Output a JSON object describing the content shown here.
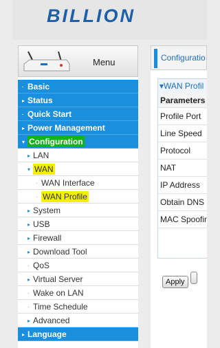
{
  "header": {
    "logo": "BILLION"
  },
  "menu": {
    "label": "Menu",
    "items": [
      {
        "label": "Basic",
        "level": "top",
        "bullet": "·"
      },
      {
        "label": "Status",
        "level": "top",
        "bullet": "▸"
      },
      {
        "label": "Quick Start",
        "level": "top",
        "bullet": "·"
      },
      {
        "label": "Power Management",
        "level": "top",
        "bullet": "▸"
      },
      {
        "label": "Configuration",
        "level": "top",
        "bullet": "▾",
        "highlight": "green"
      },
      {
        "label": "LAN",
        "level": "sub",
        "bullet": "▸"
      },
      {
        "label": "WAN",
        "level": "sub",
        "bullet": "▾",
        "highlight": "yellow"
      },
      {
        "label": "WAN Interface",
        "level": "sub2",
        "bullet": "·"
      },
      {
        "label": "WAN Profile",
        "level": "sub2",
        "bullet": "·",
        "highlight": "yellow"
      },
      {
        "label": "System",
        "level": "sub",
        "bullet": "▸"
      },
      {
        "label": "USB",
        "level": "sub",
        "bullet": "▸"
      },
      {
        "label": "Firewall",
        "level": "sub",
        "bullet": "▸"
      },
      {
        "label": "Download Tool",
        "level": "sub",
        "bullet": "▸"
      },
      {
        "label": "QoS",
        "level": "sub",
        "bullet": "·"
      },
      {
        "label": "Virtual Server",
        "level": "sub",
        "bullet": "▸"
      },
      {
        "label": "Wake on LAN",
        "level": "sub",
        "bullet": "·"
      },
      {
        "label": "Time Schedule",
        "level": "sub",
        "bullet": "·"
      },
      {
        "label": "Advanced",
        "level": "sub",
        "bullet": "▸"
      },
      {
        "label": "Language",
        "level": "top",
        "bullet": "▸"
      }
    ]
  },
  "content": {
    "header_title": "Configuratio",
    "panel_title": "▾WAN Profil",
    "table_header": "Parameters",
    "rows": [
      "Profile Port",
      "Line Speed",
      "Protocol",
      "NAT",
      "IP Address",
      "Obtain DNS",
      "MAC Spoofin"
    ],
    "apply_label": "Apply",
    "second_button_label": ""
  },
  "colors": {
    "menu_blue": "#1a8fdd",
    "highlight_yellow": "#f4f000",
    "highlight_green": "#12b41a"
  }
}
